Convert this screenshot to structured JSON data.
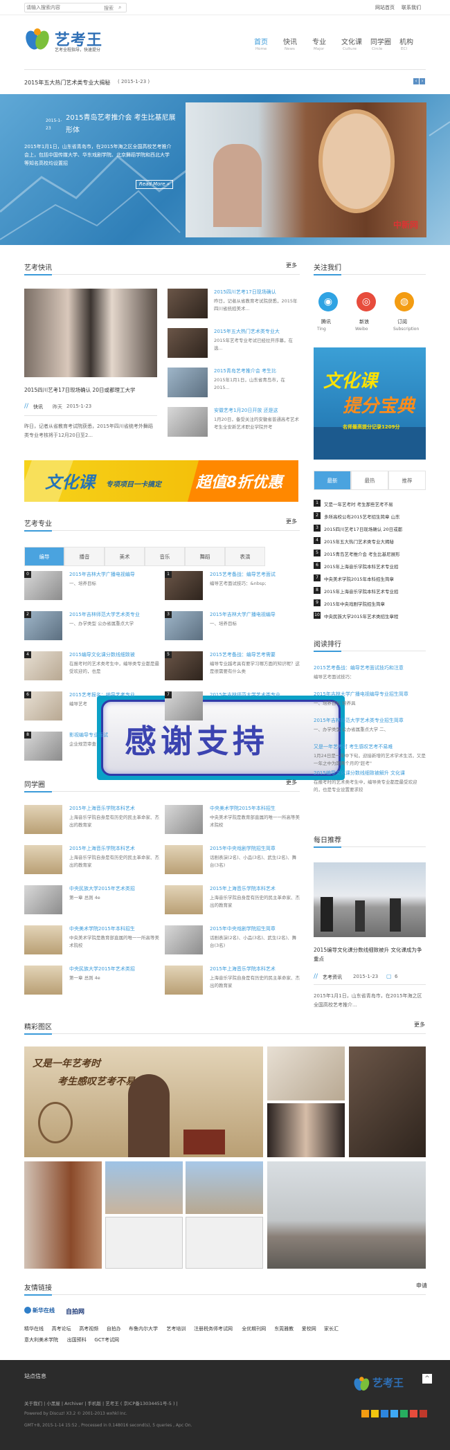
{
  "topbar": {
    "search_placeholder": "请输入搜索内容",
    "search_btn": "搜索",
    "links": [
      "网站首页",
      "联系我们"
    ]
  },
  "logo": {
    "name": "艺考王",
    "slogan": "艺考全程指导，快速提分"
  },
  "nav": [
    {
      "cn": "首页",
      "en": "Home"
    },
    {
      "cn": "快讯",
      "en": "News"
    },
    {
      "cn": "专业",
      "en": "Major"
    },
    {
      "cn": "文化课",
      "en": "Culture"
    },
    {
      "cn": "同学圈",
      "en": "Circle"
    },
    {
      "cn": "机构",
      "en": "ECI"
    }
  ],
  "headline": {
    "text": "2015年五大热门艺术类专业大揭秘",
    "date": "( 2015-1-23 )",
    "pager": [
      "‹",
      "›"
    ]
  },
  "hero": {
    "title": "2015青岛艺考推介会 考生比基尼展形体",
    "date": "2015-1-23",
    "desc": "2015年1月1日，山东省青岛市，在2015年海之区全国高校艺考推介会上，包括中国传媒大学、华东戏剧学院、北京舞蹈学院和西北大学等知名高校均设置招",
    "read_more": "Read More »",
    "watermark": "中新网"
  },
  "news": {
    "title": "艺考快讯",
    "more": "更多",
    "main": {
      "caption": "2015四川艺考17日现场确认 20日或都理工大学",
      "tag": "快讯",
      "date": "昨天",
      "date2": "2015-1-23",
      "desc": "昨日，记者从省教育考试院获悉，2015年四川省统考外舞蹈类专业考核将于12月20日至2..."
    },
    "items": [
      {
        "title": "2015四川艺考17日现场确认",
        "desc": "昨日，记者从省教育考试院获悉，2015年四川省统招美术..."
      },
      {
        "title": "2015年五大热门艺术类专业大",
        "desc": "2015年艺考专业考试已经拉开序幕，在选..."
      },
      {
        "title": "2015青岛艺考推介会 考生比",
        "desc": "2015年1月1日，山东省青岛市，在2015..."
      },
      {
        "title": "安徽艺考1月20日开放 还是这",
        "desc": "1月20日，备受关注的安徽省普通高考艺术考生全安新艺术职业学院开考"
      }
    ]
  },
  "follow": {
    "title": "关注我们",
    "items": [
      {
        "cn": "腾讯",
        "en": "Ting"
      },
      {
        "cn": "新浪",
        "en": "Weibo"
      },
      {
        "cn": "订阅",
        "en": "Subscription"
      }
    ]
  },
  "ad_side": {
    "line1": "文化课",
    "line2": "提分宝典",
    "line3": "名师最高提分记录1209分"
  },
  "banner": {
    "t1": "文化课",
    "t2": "专项项目一卡搞定",
    "t3": "超值8折优惠"
  },
  "tabs_side": {
    "tabs": [
      "最新",
      "最热",
      "推荐"
    ],
    "items": [
      "又是一年艺考时 考生那些艺考不易",
      "多所高校公布2015艺考招生简章 山东",
      "2015四川艺考17日现场确认 20日或都",
      "2015年五大热门艺术类专业大揭秘",
      "2015青岛艺考推介会 考生比基尼展形",
      "2015年上海音乐学院本科艺术专业招",
      "中央美术学院2015年本科招生简章",
      "2015年上海音乐学院本科艺术专业招",
      "2015年中央戏剧学院招生简章",
      "中央民族大学2015年艺术类招生章程"
    ]
  },
  "major": {
    "title": "艺考专业",
    "more": "更多",
    "tabs": [
      "编导",
      "播音",
      "美术",
      "音乐",
      "舞蹈",
      "表演"
    ],
    "items": [
      {
        "n": "0",
        "title": "2015年吉林大学广播电视编导",
        "desc": "一、培养目标"
      },
      {
        "n": "1",
        "title": "2015艺考备战：编导艺考面试",
        "desc": "编导艺考面试技巧：&nbsp;"
      },
      {
        "n": "2",
        "title": "2015年吉林师范大学艺术类专业",
        "desc": "一、办学类型 公办省属重点大学"
      },
      {
        "n": "3",
        "title": "2015年吉林大学广播电视编导",
        "desc": "一、培养目标"
      },
      {
        "n": "4",
        "title": "2015编导文化课分数线细致被",
        "desc": "在报考时的艺术类考生中，编导类专业都是最受欢迎的，也是"
      },
      {
        "n": "5",
        "title": "2015艺考备战：编导艺考需要",
        "desc": "编导专业越考具有要学习哪方面的知识呢？这是很需要有什么类"
      },
      {
        "n": "6",
        "title": "2015艺考报名：编导艺考专业",
        "desc": "编导艺考"
      },
      {
        "n": "7",
        "title": "2015年吉林师范大学艺术类专业",
        "desc": ""
      },
      {
        "n": "8",
        "title": "影视编导专业面试",
        "desc": "企业规范审查"
      }
    ]
  },
  "overlay": {
    "text": "感谢支持"
  },
  "reading": {
    "title": "阅读排行",
    "items": [
      {
        "title": "2015艺考备战：编导艺考面试技巧和注意",
        "desc": "编导艺考面试技巧："
      },
      {
        "title": "2015年吉林大学广播电视编导专业招生简章",
        "desc": "一、培养目标 培养具"
      },
      {
        "title": "2015年吉林师范大学艺术类专业招生简章",
        "desc": "一、办学类型 公办省属重点大学 二、"
      },
      {
        "title": "又是一年艺考时 考生感叹艺考不易难",
        "desc": "1月24日是一年中下旬，迎接新增的艺术学术生活，又是一年之中为期两个月的\"赶考\""
      },
      {
        "title": "2015编导文化课分数线细致被解升 文化课",
        "desc": "在报考时的艺术类考生中，编导类专业都是最受欢迎的，也是专业设置要求较"
      }
    ]
  },
  "circle": {
    "title": "同学圈",
    "more": "更多",
    "items": [
      {
        "title": "2015年上海音乐学院本科艺术",
        "desc": "上海音乐学院自身是有历史的民主革命家、杰出的教育家"
      },
      {
        "title": "中央美术学院2015年本科招生",
        "desc": "中央美术学院是教育部直属的唯一一所高等美术院校"
      },
      {
        "title": "2015年上海音乐学院本科艺术",
        "desc": "上海音乐学院自身是有历史的民主革命家、杰出的教育家"
      },
      {
        "title": "2015年中央戏剧学院招生简章",
        "desc": "话剧表演(2名)、小品(3名)、武生(2名)、舞台(3名)"
      },
      {
        "title": "中央民族大学2015年艺术类招",
        "desc": "第一章 总则 4e"
      },
      {
        "title": "2015年上海音乐学院本科艺术",
        "desc": "上海音乐学院自身是有历史的民主革命家、杰出的教育家"
      },
      {
        "title": "中央美术学院2015年本科招生",
        "desc": "中央美术学院是教育部直属的唯一一所高等美术院校"
      },
      {
        "title": "2015年中央戏剧学院招生简章",
        "desc": "话剧表演(2名)、小品(3名)、武生(2名)、舞台(3名)"
      },
      {
        "title": "中央民族大学2015年艺术类招",
        "desc": "第一章 总则 4e"
      },
      {
        "title": "2015年上海音乐学院本科艺术",
        "desc": "上海音乐学院自身是有历史的民主革命家、杰出的教育家"
      }
    ]
  },
  "daily": {
    "title": "每日推荐",
    "caption": "2015编导文化课分数线细致被升 文化课成为争重点",
    "tag": "艺考资讯",
    "date": "2015-1-23",
    "comments": "6",
    "desc": "2015年1月1日，山东省青岛市，在2015年海之区全国高校艺考推介..."
  },
  "gallery": {
    "title": "精彩图区",
    "more": "更多",
    "poster_line1": "又是一年艺考时",
    "poster_line2": "考生感叹艺考不易"
  },
  "friends": {
    "title": "友情链接",
    "apply": "申请",
    "logos": [
      "新华在线",
      "自拍网"
    ],
    "links": [
      "精华在线",
      "高考论坛",
      "高考视频",
      "自拍办",
      "布鲁内尔大学",
      "艺考培训",
      "注册税务师考试网",
      "全优期刊网",
      "东莞雅教",
      "爱校网",
      "家长汇",
      "意大利美术学院",
      "出国预科",
      "GCT考试网"
    ]
  },
  "footer": {
    "title": "站点信息",
    "links": "关于我们 | 小黑屋 | Archiver | 手机版 | 艺考王 ( 京ICP备13034451号-5 ) |",
    "powered": "Powered by Discuz! X3.2 © 2001-2013 wxhkl Inc.",
    "gmt": "GMT+8, 2015-1-14 15:52 , Processed in 0.148016 second(s), 5 queries , Apc On.",
    "logo": "艺考王"
  },
  "colors": {
    "accent": "#3a9ad9",
    "tab": "#4aa3df",
    "footer_bg": "#2b2b2b"
  }
}
